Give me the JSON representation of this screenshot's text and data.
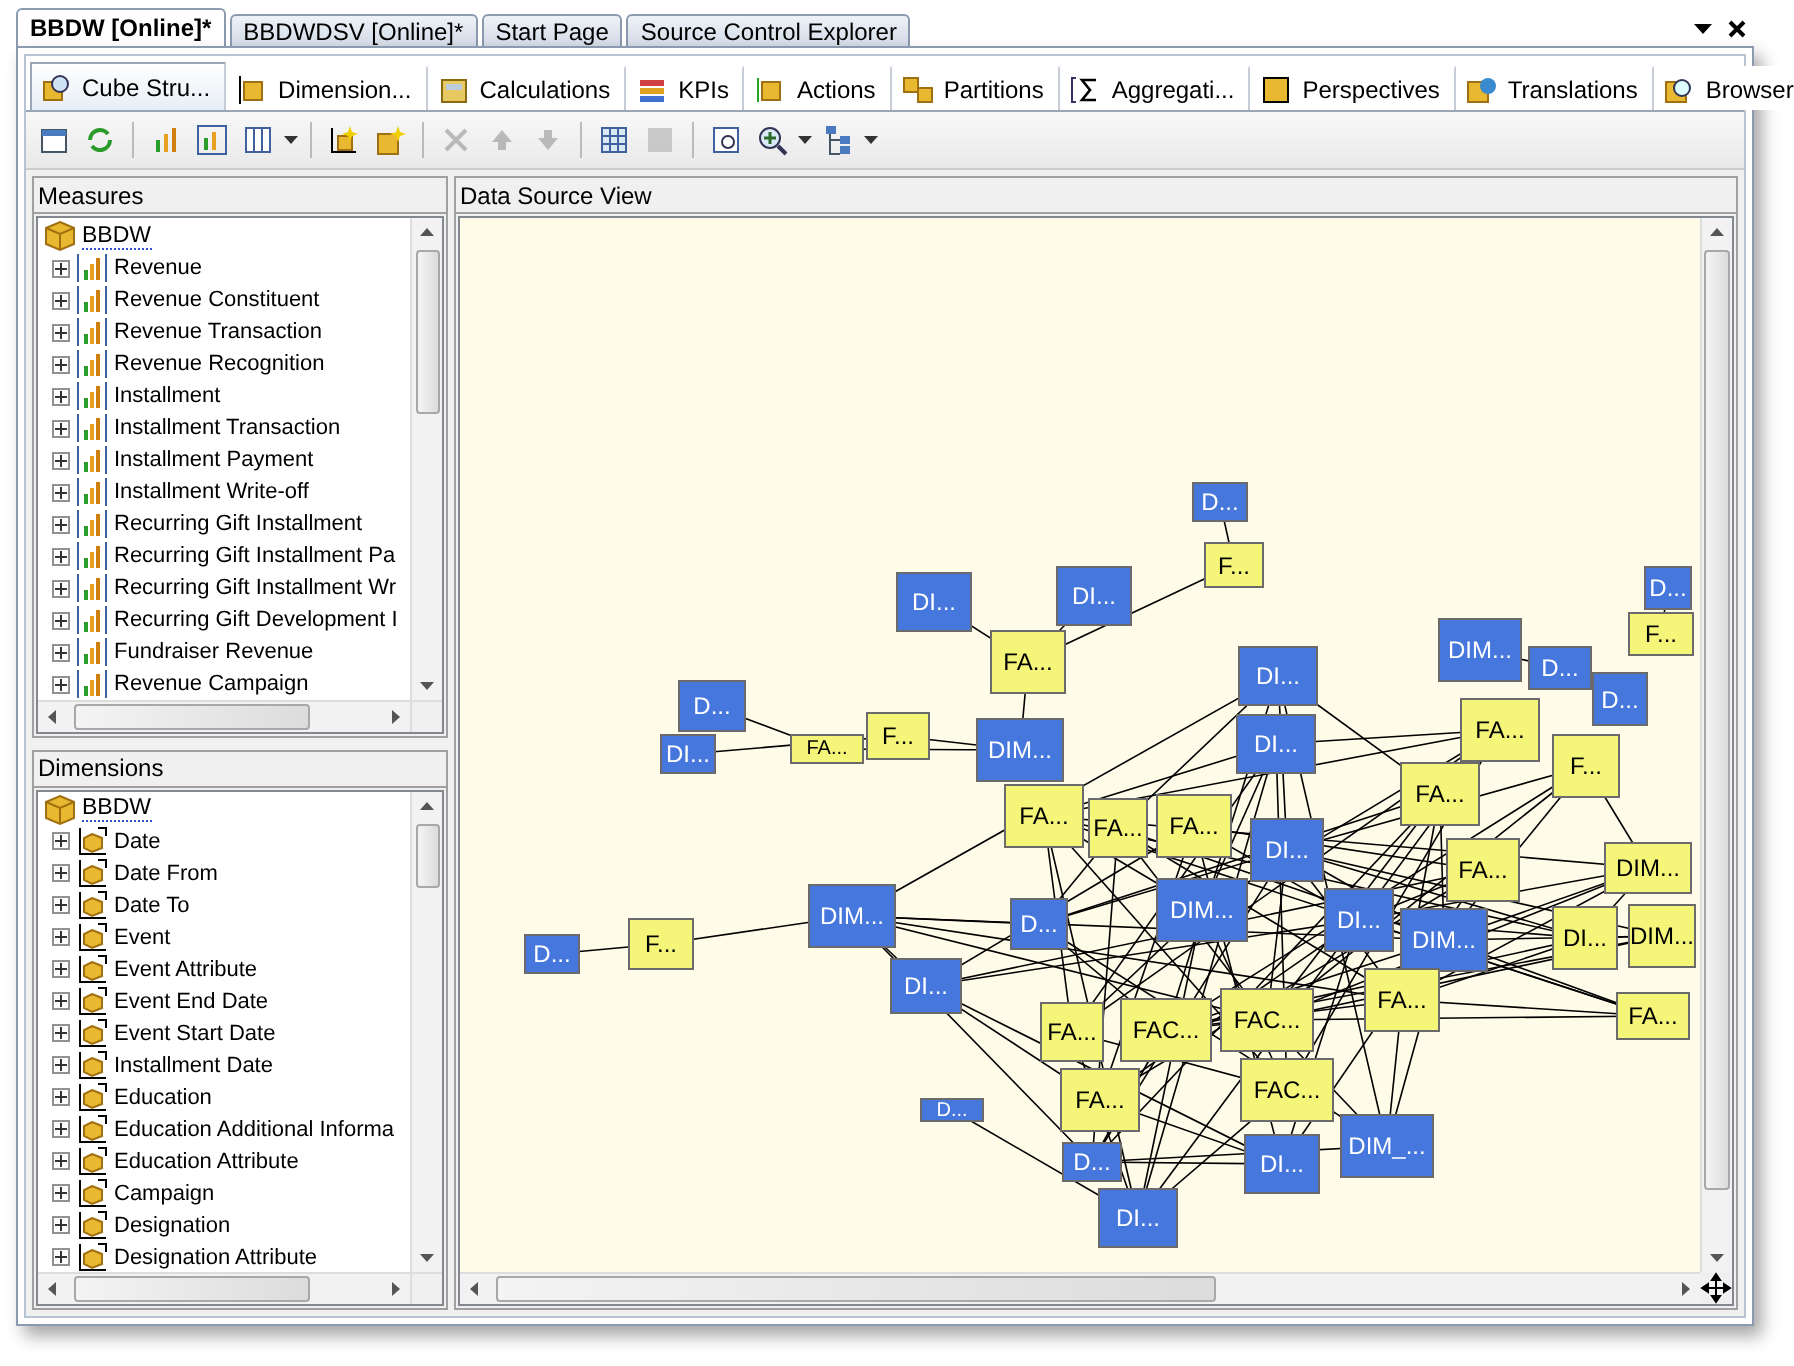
{
  "document_tabs": [
    {
      "label": "BBDW [Online]*",
      "selected": true
    },
    {
      "label": "BBDWDSV [Online]*",
      "selected": false
    },
    {
      "label": "Start Page",
      "selected": false
    },
    {
      "label": "Source Control Explorer",
      "selected": false
    }
  ],
  "designer_tabs": [
    {
      "label": "Cube Stru...",
      "selected": true
    },
    {
      "label": "Dimension...",
      "selected": false
    },
    {
      "label": "Calculations",
      "selected": false
    },
    {
      "label": "KPIs",
      "selected": false
    },
    {
      "label": "Actions",
      "selected": false
    },
    {
      "label": "Partitions",
      "selected": false
    },
    {
      "label": "Aggregati...",
      "selected": false
    },
    {
      "label": "Perspectives",
      "selected": false
    },
    {
      "label": "Translations",
      "selected": false
    },
    {
      "label": "Browser",
      "selected": false
    }
  ],
  "toolbar_buttons": [
    {
      "disabled": false
    },
    {
      "disabled": false
    },
    {
      "disabled": false
    },
    {
      "disabled": false
    },
    {
      "disabled": false
    },
    {
      "disabled": false
    },
    {
      "disabled": false
    },
    {
      "disabled": true
    },
    {
      "disabled": true
    },
    {
      "disabled": true
    },
    {
      "disabled": false
    },
    {
      "disabled": true
    },
    {
      "disabled": false
    },
    {
      "disabled": false
    },
    {
      "disabled": false
    }
  ],
  "measures": {
    "title": "Measures",
    "root": "BBDW",
    "items": [
      {
        "label": "Revenue",
        "expanded": false
      },
      {
        "label": "Revenue Constituent",
        "expanded": false
      },
      {
        "label": "Revenue Transaction",
        "expanded": false
      },
      {
        "label": "Revenue Recognition",
        "expanded": false
      },
      {
        "label": "Installment",
        "expanded": false
      },
      {
        "label": "Installment Transaction",
        "expanded": false
      },
      {
        "label": "Installment Payment",
        "expanded": false
      },
      {
        "label": "Installment Write-off",
        "expanded": false
      },
      {
        "label": "Recurring Gift Installment",
        "expanded": false
      },
      {
        "label": "Recurring Gift Installment Pa",
        "expanded": false
      },
      {
        "label": "Recurring Gift Installment Wr",
        "expanded": false
      },
      {
        "label": "Recurring Gift Development I",
        "expanded": false
      },
      {
        "label": "Fundraiser Revenue",
        "expanded": false
      },
      {
        "label": "Revenue Campaign",
        "expanded": false
      }
    ]
  },
  "dimensions": {
    "title": "Dimensions",
    "root": "BBDW",
    "items": [
      {
        "label": "Date",
        "expanded": false
      },
      {
        "label": "Date From",
        "expanded": false
      },
      {
        "label": "Date To",
        "expanded": false
      },
      {
        "label": "Event",
        "expanded": false
      },
      {
        "label": "Event Attribute",
        "expanded": false
      },
      {
        "label": "Event End Date",
        "expanded": false
      },
      {
        "label": "Event Start Date",
        "expanded": false
      },
      {
        "label": "Installment Date",
        "expanded": false
      },
      {
        "label": "Education",
        "expanded": false
      },
      {
        "label": "Education Additional Informa",
        "expanded": false
      },
      {
        "label": "Education Attribute",
        "expanded": false
      },
      {
        "label": "Campaign",
        "expanded": false
      },
      {
        "label": "Designation",
        "expanded": false
      },
      {
        "label": "Designation Attribute",
        "expanded": false
      }
    ]
  },
  "data_source_view": {
    "title": "Data Source View",
    "nodes": [
      {
        "label": "D...",
        "color": "#4677dc"
      },
      {
        "label": "F...",
        "color": "#f5f57a"
      },
      {
        "label": "DI...",
        "color": "#4677dc"
      },
      {
        "label": "DI...",
        "color": "#4677dc"
      },
      {
        "label": "FA...",
        "color": "#f5f57a"
      },
      {
        "label": "D...",
        "color": "#4677dc"
      },
      {
        "label": "DI...",
        "color": "#4677dc"
      },
      {
        "label": "FA...",
        "color": "#f5f57a"
      },
      {
        "label": "F...",
        "color": "#f5f57a"
      },
      {
        "label": "DIM...",
        "color": "#4677dc"
      },
      {
        "label": "FA...",
        "color": "#f5f57a"
      },
      {
        "label": "FA...",
        "color": "#f5f57a"
      },
      {
        "label": "FA...",
        "color": "#f5f57a"
      },
      {
        "label": "DI...",
        "color": "#4677dc"
      },
      {
        "label": "DI...",
        "color": "#4677dc"
      },
      {
        "label": "D...",
        "color": "#4677dc"
      },
      {
        "label": "F...",
        "color": "#f5f57a"
      },
      {
        "label": "DIM...",
        "color": "#4677dc"
      },
      {
        "label": "DI...",
        "color": "#4677dc"
      },
      {
        "label": "D...",
        "color": "#4677dc"
      },
      {
        "label": "DIM...",
        "color": "#4677dc"
      },
      {
        "label": "DI...",
        "color": "#4677dc"
      },
      {
        "label": "DI...",
        "color": "#4677dc"
      },
      {
        "label": "DIM...",
        "color": "#4677dc"
      },
      {
        "label": "DIM...",
        "color": "#4677dc"
      },
      {
        "label": "D...",
        "color": "#4677dc"
      },
      {
        "label": "D...",
        "color": "#4677dc"
      },
      {
        "label": "FA...",
        "color": "#f5f57a"
      },
      {
        "label": "FA...",
        "color": "#f5f57a"
      },
      {
        "label": "F...",
        "color": "#f5f57a"
      },
      {
        "label": "FA...",
        "color": "#f5f57a"
      },
      {
        "label": "D...",
        "color": "#4677dc"
      },
      {
        "label": "F...",
        "color": "#f5f57a"
      },
      {
        "label": "DIM...",
        "color": "#f5f57a"
      },
      {
        "label": "DI...",
        "color": "#f5f57a"
      },
      {
        "label": "DIM...",
        "color": "#f5f57a"
      },
      {
        "label": "FA...",
        "color": "#f5f57a"
      },
      {
        "label": "FA...",
        "color": "#f5f57a"
      },
      {
        "label": "FA...",
        "color": "#f5f57a"
      },
      {
        "label": "FAC...",
        "color": "#f5f57a"
      },
      {
        "label": "FA...",
        "color": "#f5f57a"
      },
      {
        "label": "FAC...",
        "color": "#f5f57a"
      },
      {
        "label": "FAC...",
        "color": "#f5f57a"
      },
      {
        "label": "DIM_...",
        "color": "#4677dc"
      },
      {
        "label": "DI...",
        "color": "#4677dc"
      },
      {
        "label": "D...",
        "color": "#4677dc"
      },
      {
        "label": "DI...",
        "color": "#4677dc"
      },
      {
        "label": "D...",
        "color": "#4677dc"
      }
    ]
  }
}
